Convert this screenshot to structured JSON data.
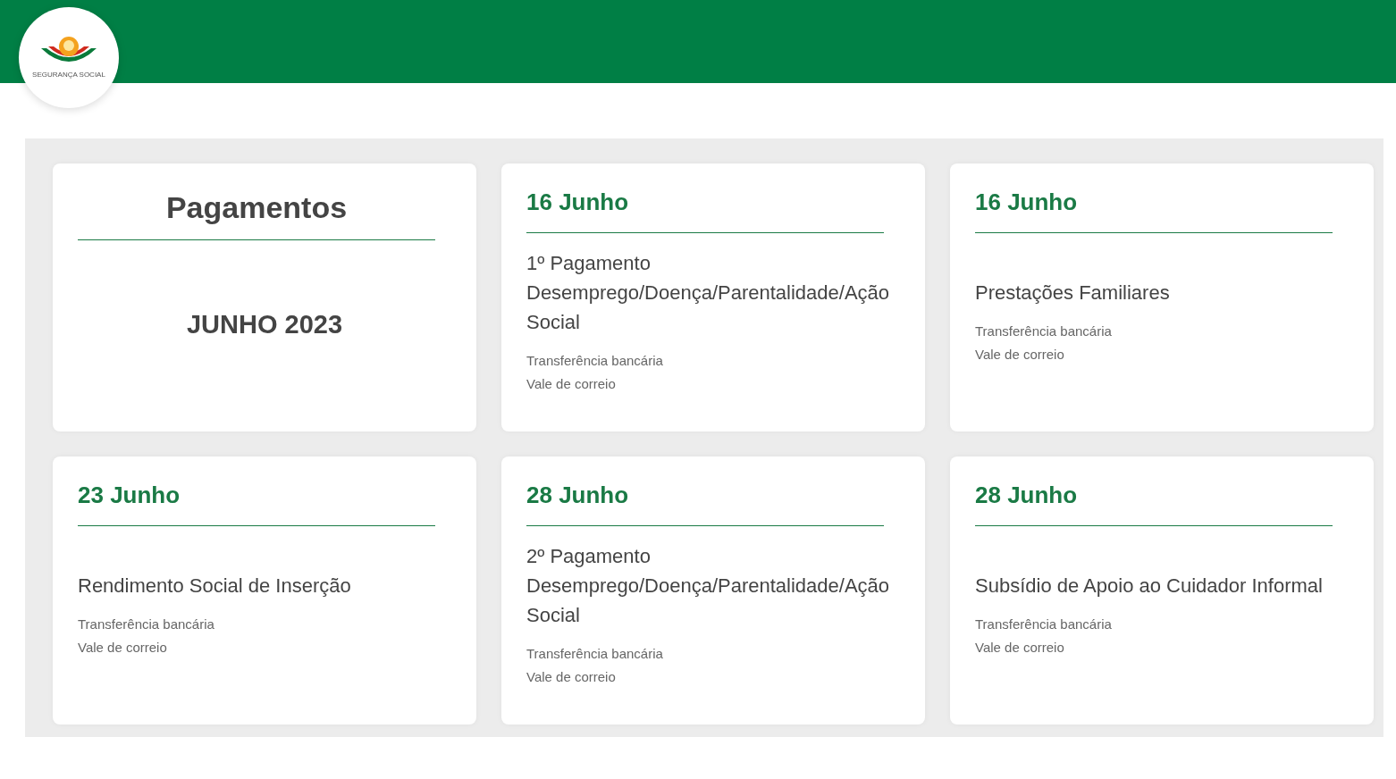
{
  "logo": {
    "text": "SEGURANÇA SOCIAL"
  },
  "cards": [
    {
      "kind": "intro",
      "title": "Pagamentos",
      "subtitle": "JUNHO 2023"
    },
    {
      "kind": "payment",
      "date": "16 Junho",
      "benefit": "1º Pagamento Desemprego/Doença/Parentalidade/Ação Social",
      "methods": [
        "Transferência bancária",
        "Vale de correio"
      ]
    },
    {
      "kind": "payment",
      "date": "16 Junho",
      "benefit": "Prestações Familiares",
      "methods": [
        "Transferência bancária",
        "Vale de correio"
      ]
    },
    {
      "kind": "payment",
      "date": "23 Junho",
      "benefit": "Rendimento Social de Inserção",
      "methods": [
        "Transferência bancária",
        "Vale de correio"
      ]
    },
    {
      "kind": "payment",
      "date": "28 Junho",
      "benefit": "2º Pagamento Desemprego/Doença/Parentalidade/Ação Social",
      "methods": [
        "Transferência bancária",
        "Vale de correio"
      ]
    },
    {
      "kind": "payment",
      "date": "28 Junho",
      "benefit": "Subsídio de Apoio ao Cuidador Informal",
      "methods": [
        "Transferência bancária",
        "Vale de correio"
      ]
    }
  ]
}
